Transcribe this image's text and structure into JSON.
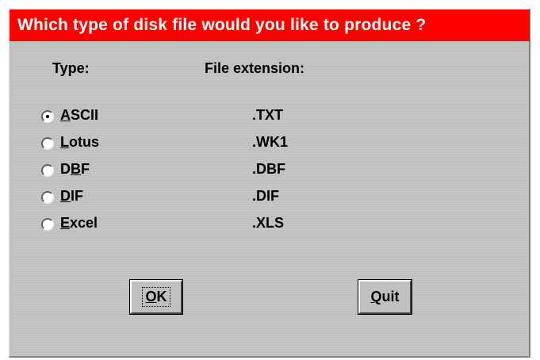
{
  "dialog": {
    "title": "Which type of disk file would you like to produce ?",
    "headers": {
      "type": "Type:",
      "extension": "File extension:"
    },
    "options": [
      {
        "first": "A",
        "rest": "SCII",
        "extension": ".TXT",
        "selected": true
      },
      {
        "first": "L",
        "rest": "otus",
        "extension": ".WK1",
        "selected": false
      },
      {
        "first": "D",
        "underlined": "B",
        "after": "F",
        "extension": ".DBF",
        "selected": false
      },
      {
        "first": "D",
        "rest": "IF",
        "extension": ".DIF",
        "selected": false
      },
      {
        "first": "E",
        "rest": "xcel",
        "extension": ".XLS",
        "selected": false
      }
    ],
    "buttons": {
      "ok": {
        "hotkey": "O",
        "rest": "K"
      },
      "quit": {
        "hotkey": "Q",
        "rest": "uit"
      }
    }
  },
  "colors": {
    "titlebar": "#ff0000",
    "title_text": "#ffffff",
    "dialog_bg": "#c0c0c0"
  }
}
